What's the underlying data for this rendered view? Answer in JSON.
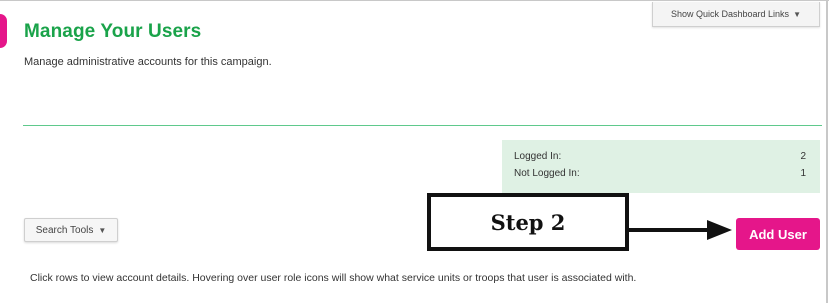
{
  "page": {
    "title": "Manage Your Users",
    "subtitle": "Manage administrative accounts for this campaign."
  },
  "quick_links": {
    "label": "Show Quick Dashboard Links",
    "caret": "▼"
  },
  "stats": {
    "logged_in_label": "Logged In:",
    "logged_in_value": "2",
    "not_logged_in_label": "Not Logged In:",
    "not_logged_in_value": "1"
  },
  "search_tools": {
    "label": "Search Tools",
    "caret": "▼"
  },
  "annotation": {
    "label": "Step 2"
  },
  "add_user": {
    "label": "Add User"
  },
  "help_text": "Click rows to view account details. Hovering over user role icons will show what service units or troops that user is associated with.",
  "colors": {
    "brand_green": "#1aa34a",
    "accent_pink": "#e5168a",
    "stats_bg": "#dff1e4"
  }
}
